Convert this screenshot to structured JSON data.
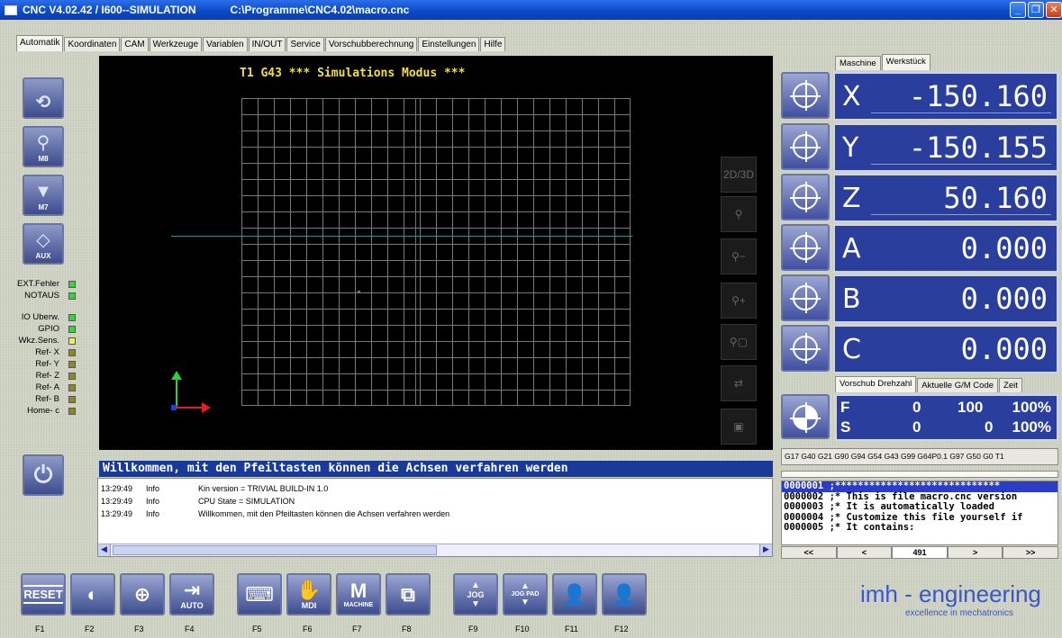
{
  "window": {
    "title": "CNC V4.02.42 / I600--SIMULATION",
    "path": "C:\\Programme\\CNC4.02\\macro.cnc"
  },
  "tabs": [
    "Automatik",
    "Koordinaten",
    "CAM",
    "Werkzeuge",
    "Variablen",
    "IN/OUT",
    "Service",
    "Vorschubberechnung",
    "Einstellungen",
    "Hilfe"
  ],
  "left_buttons": [
    {
      "label": "",
      "icon": "spindle-icon"
    },
    {
      "label": "M8",
      "icon": "coolant-icon"
    },
    {
      "label": "M7",
      "icon": "mist-icon"
    },
    {
      "label": "AUX",
      "icon": "aux-icon"
    }
  ],
  "status": [
    {
      "label": "EXT.Fehler",
      "color": "#3ad23a"
    },
    {
      "label": "NOTAUS",
      "color": "#3ad23a"
    },
    {
      "label": "IO Uberw.",
      "color": "#3ad23a"
    },
    {
      "label": "GPIO",
      "color": "#3ad23a"
    },
    {
      "label": "Wkz.Sens.",
      "color": "#f0f050"
    },
    {
      "label": "Ref- X",
      "color": "#8a8a20"
    },
    {
      "label": "Ref- Y",
      "color": "#8a8a20"
    },
    {
      "label": "Ref- Z",
      "color": "#8a8a20"
    },
    {
      "label": "Ref- A",
      "color": "#8a8a20"
    },
    {
      "label": "Ref- B",
      "color": "#8a8a20"
    },
    {
      "label": "Home- c",
      "color": "#8a8a20"
    }
  ],
  "canvas": {
    "title": "T1 G43 *** Simulations Modus ***",
    "view_buttons": [
      "2D/3D",
      "zoom-fit",
      "zoom-out",
      "zoom-in",
      "zoom-window",
      "redraw",
      "frame"
    ]
  },
  "message": {
    "banner": "Willkommen, mit den Pfeiltasten können die Achsen verfahren werden",
    "log": [
      {
        "time": "13:29:49",
        "level": "Info",
        "text": "Kin version = TRIVIAL BUILD-IN 1.0"
      },
      {
        "time": "13:29:49",
        "level": "Info",
        "text": "CPU State = SIMULATION"
      },
      {
        "time": "13:29:49",
        "level": "Info",
        "text": "Willkommen, mit den Pfeiltasten können die Achsen verfahren werden"
      }
    ]
  },
  "coord_tabs": [
    "Maschine",
    "Werkstück"
  ],
  "axes": [
    {
      "axis": "X",
      "value": "-150.160"
    },
    {
      "axis": "Y",
      "value": "-150.155"
    },
    {
      "axis": "Z",
      "value": "50.160"
    },
    {
      "axis": "A",
      "value": "0.000"
    },
    {
      "axis": "B",
      "value": "0.000"
    },
    {
      "axis": "C",
      "value": "0.000"
    }
  ],
  "feed_tabs": [
    "Vorschub Drehzahl",
    "Aktuelle G/M Code",
    "Zeit"
  ],
  "feed": {
    "label": "F",
    "value": "0",
    "set": "100",
    "pct": "100%"
  },
  "spindle": {
    "label": "S",
    "value": "0",
    "set": "0",
    "pct": "100%"
  },
  "gcode_line": "G17 G40 G21 G90 G94 G54 G43 G99 G64P0.1 G97 G50 G0 T1",
  "program": [
    "0000001 ;*****************************",
    "0000002 ;* This is file macro.cnc version",
    "0000003 ;* It is automatically loaded",
    "0000004 ;* Customize this file yourself if",
    "0000005 ;* It contains:"
  ],
  "program_nav": [
    "<<",
    "<",
    "491",
    ">",
    ">>"
  ],
  "fkeys": [
    {
      "key": "F1",
      "label": "RESET",
      "icon": ""
    },
    {
      "key": "F2",
      "label": "",
      "icon": "zero-point-icon"
    },
    {
      "key": "F3",
      "label": "",
      "icon": "crosshair-icon"
    },
    {
      "key": "F4",
      "label": "AUTO",
      "icon": "auto-icon"
    },
    {
      "key": "F5",
      "label": "",
      "icon": "keyboard-icon"
    },
    {
      "key": "F6",
      "label": "MDI",
      "icon": "hand-icon"
    },
    {
      "key": "F7",
      "label": "MACHINE",
      "icon": "machine-icon"
    },
    {
      "key": "F8",
      "label": "",
      "icon": "shapes-icon"
    },
    {
      "key": "F9",
      "label": "JOG",
      "icon": "jog-icon"
    },
    {
      "key": "F10",
      "label": "JOG PAD",
      "icon": "jogpad-icon"
    },
    {
      "key": "F11",
      "label": "",
      "icon": "user-icon"
    },
    {
      "key": "F12",
      "label": "",
      "icon": "user-icon"
    }
  ],
  "brand": {
    "name": "imh - engineering",
    "tagline": "excellence in mechatronics"
  }
}
